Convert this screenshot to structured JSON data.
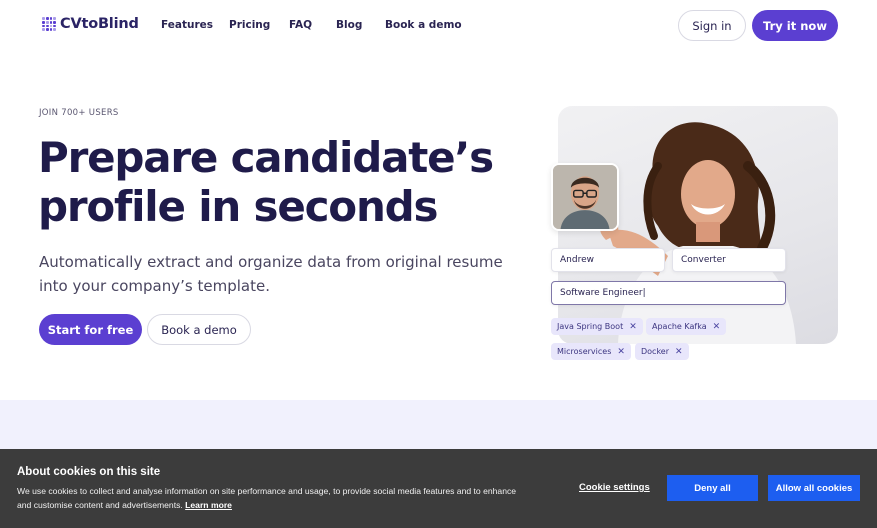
{
  "nav": {
    "logo_text": "CVtoBlind",
    "links": [
      "Features",
      "Pricing",
      "FAQ",
      "Blog",
      "Book a demo"
    ],
    "signin_label": "Sign in",
    "try_label": "Try it now"
  },
  "hero": {
    "eyebrow": "JOIN 700+ USERS",
    "headline_line1": "Prepare candidate’s",
    "headline_line2": "profile in seconds",
    "subtext": "Automatically extract and organize data from original resume into your company’s template.",
    "start_label": "Start for free",
    "demo_label": "Book a demo"
  },
  "form_preview": {
    "first_name": "Andrew",
    "last_name": "Converter",
    "position": "Software Engineer|",
    "tags": [
      "Java Spring Boot",
      "Apache Kafka",
      "Microservices",
      "Docker"
    ],
    "tag_remove_glyph": "✕"
  },
  "cookie": {
    "title": "About cookies on this site",
    "text": "We use cookies to collect and analyse information on site performance and usage, to provide social media features and to enhance and customise content and advertisements.",
    "learn_more": "Learn more",
    "settings_label": "Cookie settings",
    "deny_label": "Deny all",
    "allow_label": "Allow all cookies"
  },
  "colors": {
    "brand": "#5b3fd1",
    "heading": "#1f1b4a",
    "cookie_bg": "#3c3c3c",
    "cookie_button": "#1d5ef0",
    "tag_bg": "#e8e6fb"
  }
}
